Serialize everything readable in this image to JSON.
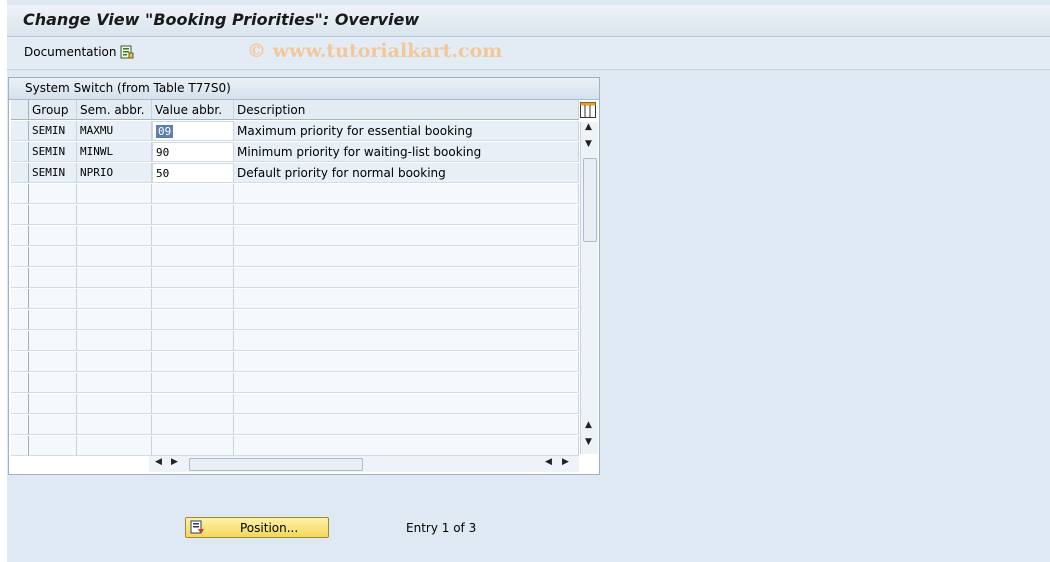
{
  "title": "Change View \"Booking Priorities\": Overview",
  "toolbar": {
    "documentation_label": "Documentation"
  },
  "watermark": "© www.tutorialkart.com",
  "panel": {
    "title": "System Switch (from Table T77S0)",
    "columns": [
      "Group",
      "Sem. abbr.",
      "Value abbr.",
      "Description"
    ],
    "rows": [
      {
        "group": "SEMIN",
        "sem": "MAXMU",
        "value": "09",
        "desc": "Maximum priority for essential booking"
      },
      {
        "group": "SEMIN",
        "sem": "MINWL",
        "value": "90",
        "desc": "Minimum priority for waiting-list booking"
      },
      {
        "group": "SEMIN",
        "sem": "NPRIO",
        "value": "50",
        "desc": "Default priority for normal booking"
      }
    ]
  },
  "footer": {
    "position_label": "Position...",
    "entry_text": "Entry 1 of 3"
  }
}
